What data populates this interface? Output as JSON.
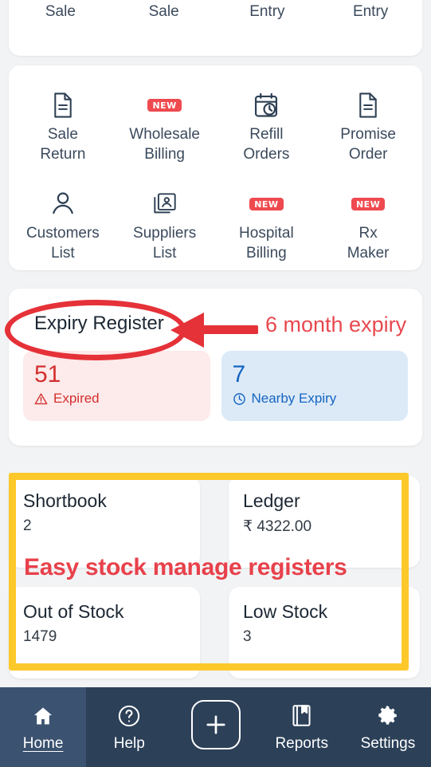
{
  "top_card": {
    "tiles": [
      {
        "label": "Sale"
      },
      {
        "label": "Sale"
      },
      {
        "label": "Entry"
      },
      {
        "label": "Entry"
      }
    ]
  },
  "menu_card": {
    "items": [
      {
        "label": "Sale\nReturn",
        "icon": "document-icon",
        "badge": ""
      },
      {
        "label": "Wholesale\nBilling",
        "icon": "none",
        "badge": "NEW"
      },
      {
        "label": "Refill\nOrders",
        "icon": "calendar-clock-icon",
        "badge": ""
      },
      {
        "label": "Promise\nOrder",
        "icon": "document-icon",
        "badge": ""
      },
      {
        "label": "Customers\nList",
        "icon": "person-icon",
        "badge": ""
      },
      {
        "label": "Suppliers\nList",
        "icon": "contact-card-icon",
        "badge": ""
      },
      {
        "label": "Hospital\nBilling",
        "icon": "none",
        "badge": "NEW"
      },
      {
        "label": "Rx\nMaker",
        "icon": "none",
        "badge": "NEW"
      }
    ]
  },
  "expiry": {
    "title": "Expiry Register",
    "expired": {
      "count": "51",
      "label": "Expired",
      "icon": "warning-triangle-icon",
      "color": "#d32f2f"
    },
    "nearby": {
      "count": "7",
      "label": "Nearby Expiry",
      "icon": "clock-icon",
      "color": "#1565c0"
    }
  },
  "stock": {
    "cards": [
      {
        "title": "Shortbook",
        "value": "2"
      },
      {
        "title": "Ledger",
        "value": "₹ 4322.00"
      },
      {
        "title": "Out of Stock",
        "value": "1479"
      },
      {
        "title": "Low Stock",
        "value": "3"
      }
    ]
  },
  "annotations": {
    "expiry_note": "6 month expiry",
    "stock_note": "Easy stock manage registers",
    "ellipse_color": "#e53138",
    "arrow_color": "#e53138",
    "box_color": "#fdc82a",
    "note_text_color": "#e8484f"
  },
  "bottom_nav": {
    "items": [
      {
        "label": "Home",
        "icon": "home-icon",
        "active": true
      },
      {
        "label": "Help",
        "icon": "question-circle-icon",
        "active": false
      },
      {
        "label": "",
        "icon": "plus-icon",
        "active": false
      },
      {
        "label": "Reports",
        "icon": "book-icon",
        "active": false
      },
      {
        "label": "Settings",
        "icon": "gear-icon",
        "active": false
      }
    ]
  }
}
